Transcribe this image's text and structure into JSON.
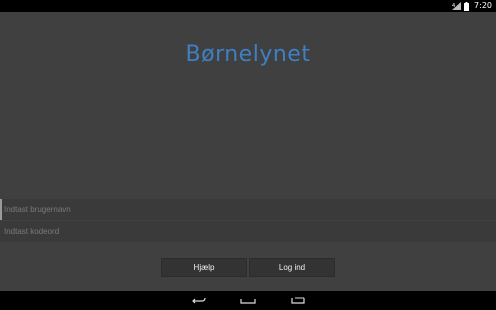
{
  "status_bar": {
    "time": "7:20",
    "icons": [
      "signal-icon",
      "battery-icon"
    ]
  },
  "app": {
    "logo_text": "Børnelynet",
    "logo_color": "#3f7fc4",
    "username_field": {
      "value": "",
      "placeholder": "Indtast brugernavn"
    },
    "password_field": {
      "value": "",
      "placeholder": "Indtast kodeord"
    },
    "help_button": "Hjælp",
    "login_button": "Log ind"
  },
  "nav_bar": {
    "buttons": [
      "back-icon",
      "home-icon",
      "recent-apps-icon"
    ]
  }
}
